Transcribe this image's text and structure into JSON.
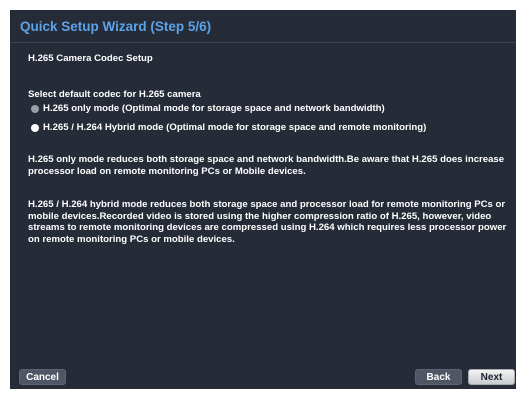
{
  "window": {
    "title": "Quick Setup Wizard (Step 5/6)"
  },
  "section": {
    "heading": "H.265 Camera Codec Setup",
    "codec_prompt": "Select default codec for H.265 camera"
  },
  "codec_options": [
    {
      "label": "H.265 only mode (Optimal mode for storage space and network bandwidth)",
      "selected": false
    },
    {
      "label": "H.265 / H.264 Hybrid mode (Optimal mode for storage space and remote monitoring)",
      "selected": true
    }
  ],
  "descriptions": {
    "h265_only": "H.265 only mode reduces both storage space and network bandwidth.Be aware that H.265 does increase processor load on remote monitoring PCs or Mobile devices.",
    "hybrid": "H.265 / H.264 hybrid mode reduces both storage space and processor load for remote monitoring PCs or mobile devices.Recorded video is stored using the higher compression ratio of H.265, however, video streams to remote monitoring devices are compressed using H.264 which requires less processor power on remote monitoring PCs or mobile devices."
  },
  "buttons": {
    "cancel": "Cancel",
    "back": "Back",
    "next": "Next"
  },
  "colors": {
    "background": "#262b38",
    "title": "#5ba2e8",
    "text": "#ffffff"
  }
}
